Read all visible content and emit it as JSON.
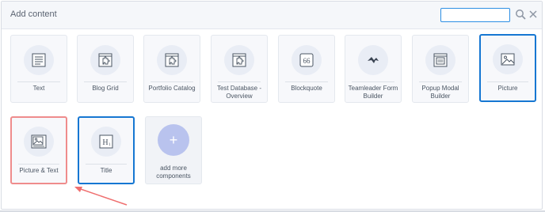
{
  "header": {
    "title": "Add content",
    "search_value": "",
    "search_icon": "search-icon",
    "close_icon": "close-icon"
  },
  "tiles": [
    {
      "label": "Text",
      "icon": "text-icon"
    },
    {
      "label": "Blog Grid",
      "icon": "puzzle-icon"
    },
    {
      "label": "Portfolio Catalog",
      "icon": "puzzle-icon"
    },
    {
      "label": "Test Database - Overview",
      "icon": "puzzle-icon"
    },
    {
      "label": "Blockquote",
      "icon": "quote-icon"
    },
    {
      "label": "Teamleader Form Builder",
      "icon": "teamleader-icon"
    },
    {
      "label": "Popup Modal Builder",
      "icon": "popup-icon"
    },
    {
      "label": "Picture",
      "icon": "picture-icon"
    },
    {
      "label": "Picture & Text",
      "icon": "picture-text-icon"
    },
    {
      "label": "Title",
      "icon": "title-icon"
    }
  ],
  "add_more": {
    "label": "add more components",
    "symbol": "+"
  },
  "colors": {
    "selected": "#1677d2",
    "highlight": "#ef8c8c",
    "accent": "#2d8fe4"
  }
}
